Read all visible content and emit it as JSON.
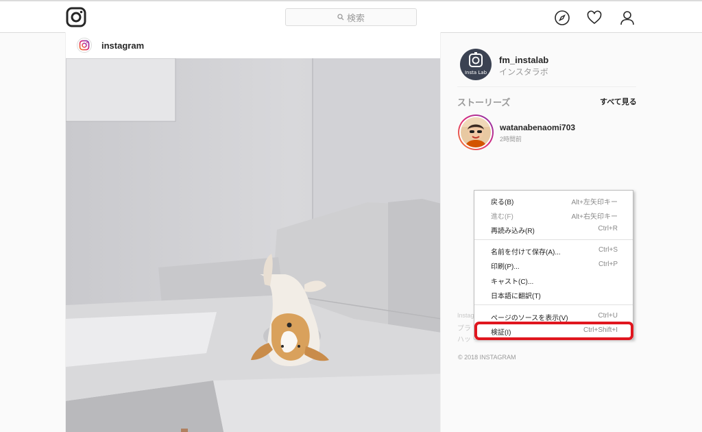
{
  "navbar": {
    "search_placeholder": "検索",
    "icons": [
      "instagram-logo-icon",
      "search-icon",
      "compass-icon",
      "heart-icon",
      "user-icon"
    ]
  },
  "post": {
    "username": "instagram"
  },
  "sidebar": {
    "profile_name": "fm_instalab",
    "profile_subtitle": "インスタラボ",
    "profile_avatar_text": "Insta Lab",
    "stories_title": "ストーリーズ",
    "see_all": "すべて見る",
    "story": {
      "username": "watanabenaomi703",
      "time": "2時間前"
    },
    "footer_lines": [
      "Instag",
      "プラ",
      "ハッ"
    ],
    "copyright": "© 2018 INSTAGRAM"
  },
  "context_menu": {
    "items": [
      {
        "label": "戻る(B)",
        "shortcut": "Alt+左矢印キー",
        "disabled": false
      },
      {
        "label": "進む(F)",
        "shortcut": "Alt+右矢印キー",
        "disabled": true
      },
      {
        "label": "再読み込み(R)",
        "shortcut": "Ctrl+R",
        "disabled": false
      },
      {
        "label": "名前を付けて保存(A)...",
        "shortcut": "Ctrl+S",
        "disabled": false
      },
      {
        "label": "印刷(P)...",
        "shortcut": "Ctrl+P",
        "disabled": false
      },
      {
        "label": "キャスト(C)...",
        "shortcut": "",
        "disabled": false
      },
      {
        "label": "日本語に翻訳(T)",
        "shortcut": "",
        "disabled": false
      },
      {
        "label": "ページのソースを表示(V)",
        "shortcut": "Ctrl+U",
        "disabled": false
      },
      {
        "label": "検証(I)",
        "shortcut": "Ctrl+Shift+I",
        "disabled": false,
        "highlighted": true
      }
    ]
  },
  "colors": {
    "highlight": "#e0161f",
    "story_gradient": [
      "#f58529",
      "#dd2a7b",
      "#8134af"
    ]
  }
}
